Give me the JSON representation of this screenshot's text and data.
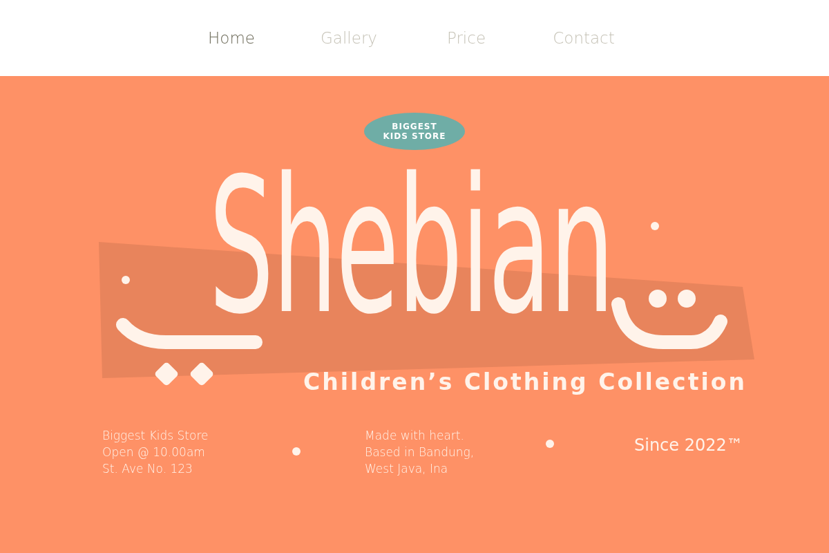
{
  "nav": [
    {
      "label": "Home",
      "selected": true
    },
    {
      "label": "Gallery",
      "selected": false
    },
    {
      "label": "Price",
      "selected": false
    },
    {
      "label": "Contact",
      "selected": false
    }
  ],
  "hero": {
    "badge": [
      "BIGGEST",
      "KIDS STORE"
    ],
    "title": "Shebian",
    "subtitle": "Children’s Clothing Collection"
  },
  "info": {
    "left": [
      "Biggest Kids Store",
      "Open @ 10.00am",
      "St. Ave No. 123"
    ],
    "middle": [
      "Made with heart.",
      "Based in Bandung,",
      "West Java, Ina"
    ],
    "right": "Since 2022™"
  }
}
